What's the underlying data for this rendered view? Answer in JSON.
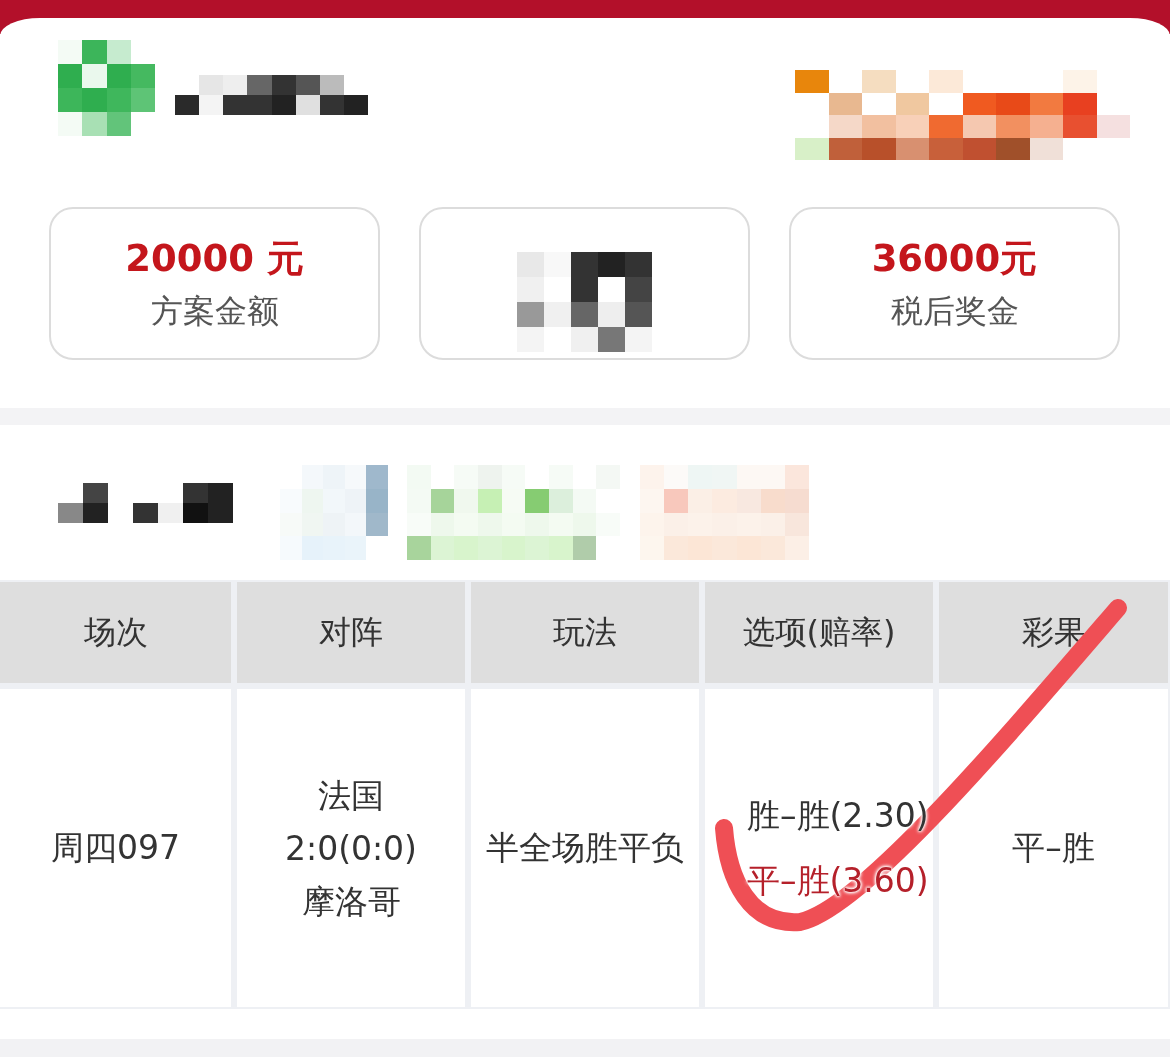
{
  "stat_cards": [
    {
      "kind": "amount",
      "value": "20000 元",
      "label": "方案金额"
    },
    {
      "kind": "pixelated"
    },
    {
      "kind": "amount",
      "value": "36000元",
      "label": "税后奖金"
    }
  ],
  "table": {
    "columns": [
      "场次",
      "对阵",
      "玩法",
      "选项(赔率)",
      "彩果"
    ],
    "rows": [
      {
        "match_no": "周四097",
        "teams": {
          "home": "法国",
          "score": "2:0(0:0)",
          "away": "摩洛哥"
        },
        "play_type": "半全场胜平负",
        "options": [
          {
            "text": "胜–胜(2.30)",
            "winning": false
          },
          {
            "text": "平–胜(3.60)",
            "winning": true
          }
        ],
        "result": "平–胜"
      }
    ]
  }
}
